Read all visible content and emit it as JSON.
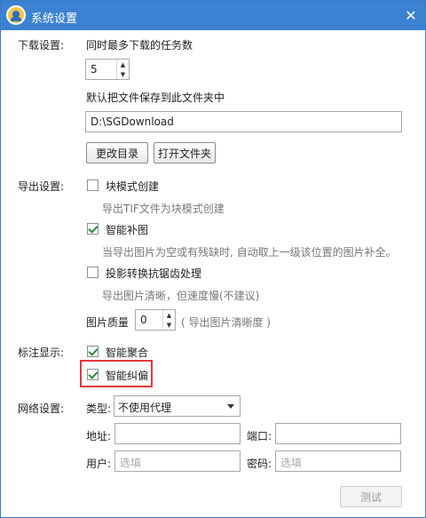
{
  "window": {
    "title": "系统设置",
    "close_symbol": "✕"
  },
  "download": {
    "section_label": "下载设置:",
    "max_tasks_label": "同时最多下载的任务数",
    "max_tasks_value": "5",
    "save_dir_label": "默认把文件保存到此文件夹中",
    "save_dir_value": "D:\\SGDownload",
    "change_dir_button": "更改目录",
    "open_folder_button": "打开文件夹"
  },
  "export": {
    "section_label": "导出设置:",
    "block_mode_label": "块模式创建",
    "block_mode_checked": false,
    "block_mode_hint": "导出TIF文件为块模式创建",
    "smart_fill_label": "智能补图",
    "smart_fill_checked": true,
    "smart_fill_hint": "当导出图片为空或有残缺时, 自动取上一级该位置的图片补全。",
    "antialias_label": "投影转换抗锯齿处理",
    "antialias_checked": false,
    "antialias_hint": "导出图片清晰，但速度慢(不建议)",
    "quality_label": "图片质量",
    "quality_value": "0",
    "quality_hint": "( 导出图片清晰度 )"
  },
  "annotation": {
    "section_label": "标注显示:",
    "smart_aggregate_label": "智能聚合",
    "smart_aggregate_checked": true,
    "smart_correct_label": "智能纠偏",
    "smart_correct_checked": true,
    "highlight_color": "#e03a3a"
  },
  "network": {
    "section_label": "网络设置:",
    "type_label": "类型:",
    "type_value": "不使用代理",
    "address_label": "地址:",
    "address_value": "",
    "port_label": "端口:",
    "port_value": "",
    "user_label": "用户:",
    "user_placeholder": "选填",
    "password_label": "密码:",
    "password_placeholder": "选填",
    "test_button": "测试"
  },
  "colors": {
    "titlebar": "#3c82d2",
    "accent_check": "#2b8a3e"
  }
}
